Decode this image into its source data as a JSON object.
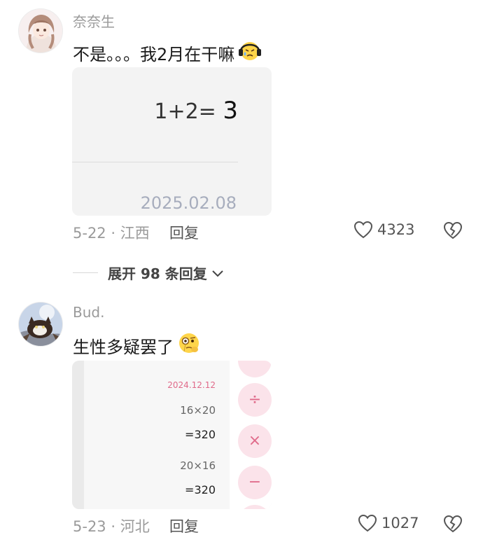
{
  "comments": [
    {
      "username": "奈奈生",
      "text": "不是。。。我2月在干嘛",
      "emoji_icon": "headphone-sad-face-icon",
      "image": {
        "expression": "1+2=",
        "result": "3",
        "date": "2025.02.08"
      },
      "date": "5-22",
      "location": "江西",
      "reply_label": "回复",
      "likes": "4323"
    },
    {
      "username": "Bud.",
      "text": "生性多疑罢了",
      "emoji_icon": "monocle-face-icon",
      "image": {
        "date": "2024.12.12",
        "lines": [
          "16×20",
          "=320",
          "20×16",
          "=320"
        ],
        "buttons": [
          "÷",
          "×",
          "−"
        ]
      },
      "date": "5-23",
      "location": "河北",
      "reply_label": "回复",
      "likes": "1027"
    }
  ],
  "expand_replies": {
    "label": "展开 98 条回复"
  },
  "colors": {
    "accent_pink": "#e06a8a",
    "button_pink": "#fbe3ea",
    "muted": "#9a9a9a"
  }
}
